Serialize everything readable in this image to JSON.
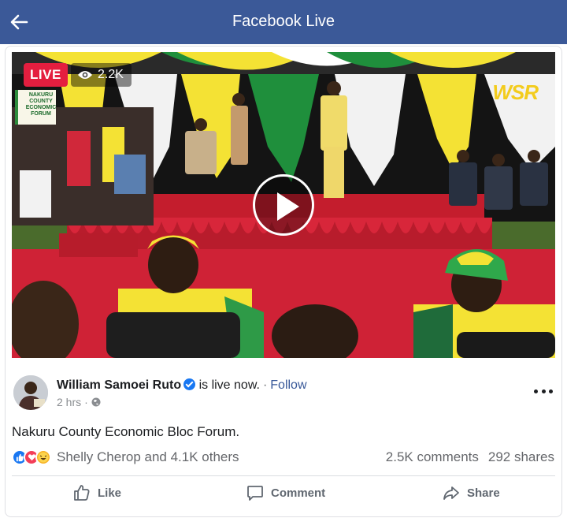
{
  "header": {
    "title": "Facebook Live",
    "back_icon": "back-arrow-icon"
  },
  "video": {
    "live_label": "LIVE",
    "viewers": "2.2K",
    "viewers_icon": "eye-icon",
    "play_icon": "play-icon",
    "channel_logo": "WSR",
    "stage_banner": "NAKURU COUNTY ECONOMIC FORUM"
  },
  "post": {
    "author": "William Samoei Ruto",
    "verified_icon": "verified-badge-icon",
    "status": "is live now.",
    "separator": "·",
    "follow_label": "Follow",
    "time": "2 hrs",
    "privacy_icon": "globe-icon",
    "more_icon": "more-options-icon",
    "text": "Nakuru County Economic Bloc Forum."
  },
  "engagement": {
    "reaction_icons": [
      "like-icon",
      "love-icon",
      "haha-icon"
    ],
    "reaction_names": "Shelly Cherop and 4.1K others",
    "comments": "2.5K comments",
    "shares": "292 shares"
  },
  "actions": {
    "like": "Like",
    "comment": "Comment",
    "share": "Share"
  },
  "colors": {
    "header_bg": "#3b5998",
    "live_red": "#e41e3f",
    "link_blue": "#385898",
    "verified_blue": "#1877f2"
  }
}
